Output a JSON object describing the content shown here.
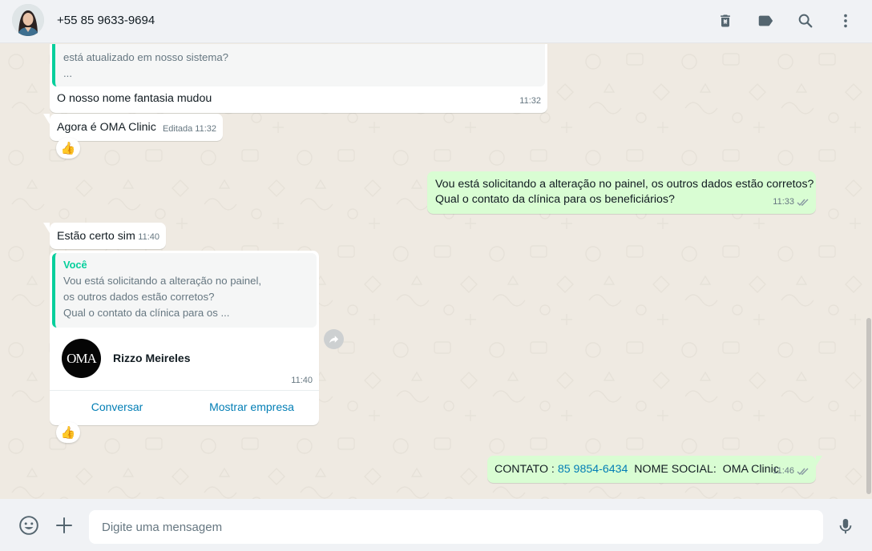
{
  "header": {
    "contact_name": "+55 85 9633-9694",
    "icons": [
      "delete-icon",
      "label-icon",
      "search-icon",
      "menu-icon"
    ]
  },
  "messages": {
    "m1": {
      "quote_line_2": "está atualizado em nosso sistema?",
      "quote_line_3": "...",
      "text": "O nosso nome fantasia mudou",
      "time": "11:32"
    },
    "m2": {
      "text": "Agora é OMA Clinic",
      "edited": "Editada",
      "time": "11:32",
      "reaction": "👍"
    },
    "m3": {
      "line1": "Vou está solicitando a alteração no painel, os outros dados estão corretos?",
      "line2": "Qual o contato da clínica para os beneficiários?",
      "time": "11:33"
    },
    "m4": {
      "text": "Estão certo sim",
      "time": "11:40"
    },
    "m5": {
      "quote_name": "Você",
      "quote_line_1": "Vou está solicitando a alteração no painel,",
      "quote_line_2": "os outros dados estão corretos?",
      "quote_line_3": "Qual o contato da clínica para os ...",
      "business_logo_text": "OMA",
      "business_name": "Rizzo Meireles",
      "time": "11:40",
      "action_chat": "Conversar",
      "action_business": "Mostrar empresa",
      "reaction": "👍"
    },
    "m6": {
      "prefix": "CONTATO : ",
      "phone": "85 9854-6434",
      "suffix": "  NOME SOCIAL:  OMA Clinic",
      "time": "11:46"
    }
  },
  "composer": {
    "placeholder": "Digite uma mensagem"
  },
  "colors": {
    "outgoing_bubble": "#d9fdd3",
    "incoming_bubble": "#ffffff",
    "accent": "#06cf9c",
    "link": "#027eb5",
    "read_ticks": "#8696a0"
  }
}
